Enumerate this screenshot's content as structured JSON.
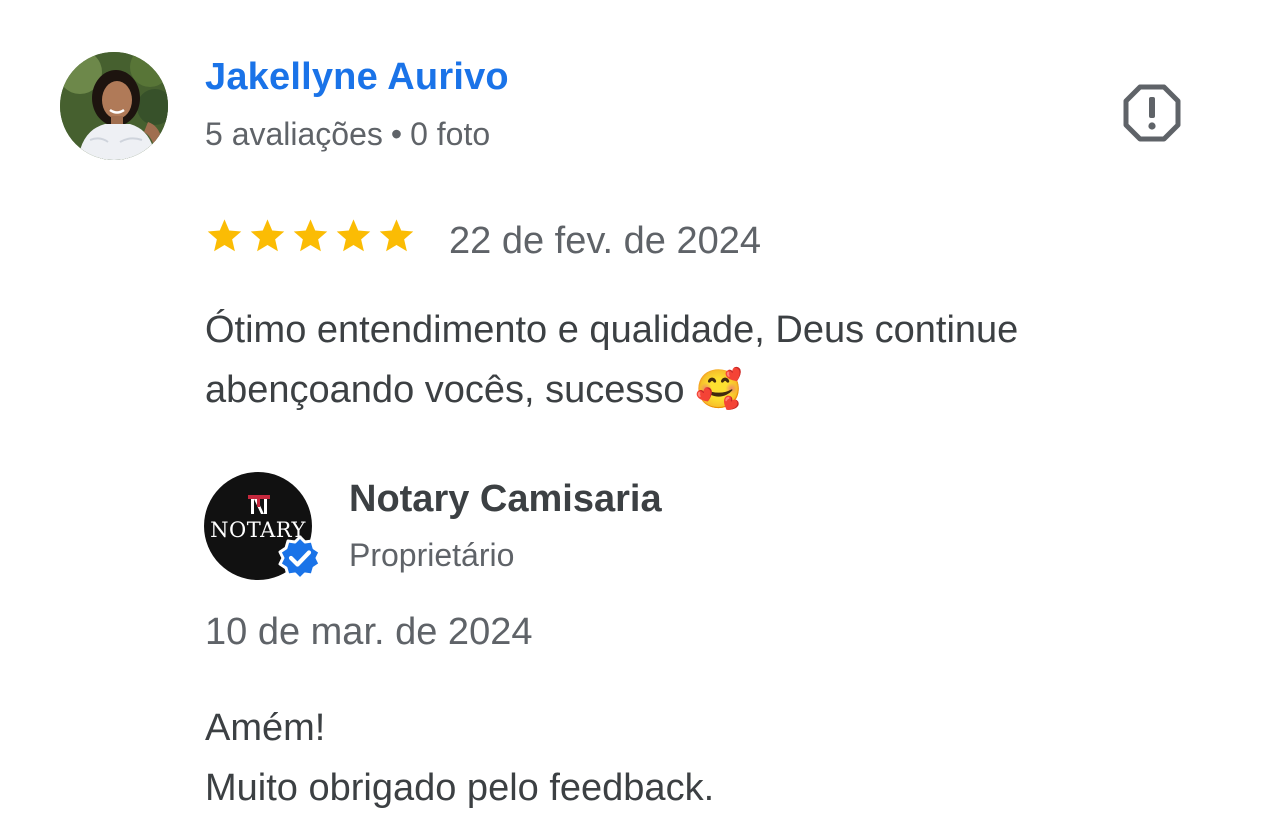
{
  "review": {
    "reviewer_name": "Jakellyne Aurivo",
    "reviews_count": "5 avaliações",
    "separator": "•",
    "photos_count": "0 foto",
    "rating": 5,
    "rating_max": 5,
    "date": "22 de fev. de 2024",
    "text": "Ótimo entendimento e qualidade, Deus continue abençoando vocês, sucesso 🥰"
  },
  "reply": {
    "owner_name": "Notary Camisaria",
    "owner_role": "Proprietário",
    "logo_text": "NOTARY",
    "date": "10 de mar. de 2024",
    "lines": [
      "Amém!",
      "Muito obrigado pelo feedback."
    ]
  },
  "colors": {
    "name_link": "#1a73e8",
    "star": "#fbbc04",
    "verified": "#1a73e8",
    "text": "#3c4043",
    "muted": "#5f6368"
  },
  "icons": {
    "report": "report-flag-icon",
    "verified": "verified-check-icon",
    "star": "star-icon"
  }
}
